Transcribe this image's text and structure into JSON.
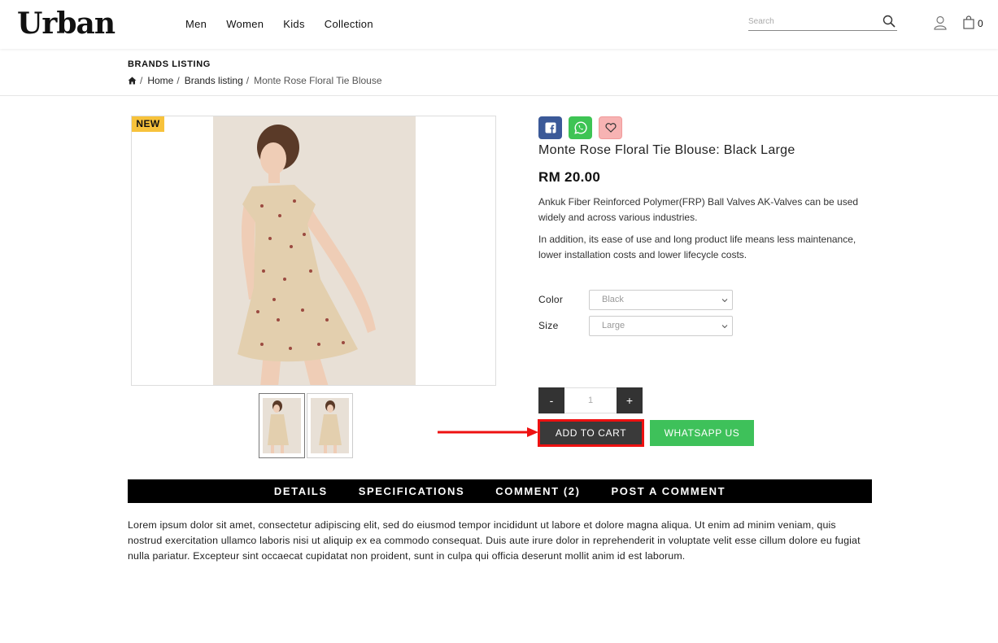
{
  "header": {
    "logo": "Urban",
    "nav": [
      "Men",
      "Women",
      "Kids",
      "Collection"
    ],
    "search_placeholder": "Search",
    "cart_count": "0"
  },
  "breadcrumb": {
    "title": "BRANDS LISTING",
    "items": [
      "Home",
      "Brands listing"
    ],
    "current": "Monte Rose Floral Tie Blouse",
    "separator": "/"
  },
  "product": {
    "badge": "NEW",
    "title": "Monte Rose Floral Tie Blouse: Black Large",
    "price": "RM 20.00",
    "description": [
      "Ankuk Fiber Reinforced Polymer(FRP) Ball Valves AK-Valves can be used widely and across various industries.",
      "In addition, its ease of use and long product life means less maintenance, lower installation costs and lower lifecycle costs."
    ],
    "options": {
      "color_label": "Color",
      "color_value": "Black",
      "size_label": "Size",
      "size_value": "Large"
    },
    "quantity": "1",
    "qty_minus": "-",
    "qty_plus": "+",
    "add_to_cart": "ADD TO CART",
    "whatsapp": "WHATSAPP US"
  },
  "tabs": [
    "DETAILS",
    "SPECIFICATIONS",
    "COMMENT (2)",
    "POST A COMMENT"
  ],
  "details_text": "Lorem ipsum dolor sit amet, consectetur adipiscing elit, sed do eiusmod tempor incididunt ut labore et dolore magna aliqua. Ut enim ad minim veniam, quis nostrud exercitation ullamco laboris nisi ut aliquip ex ea commodo consequat. Duis aute irure dolor in reprehenderit in voluptate velit esse cillum dolore eu fugiat nulla pariatur. Excepteur sint occaecat cupidatat non proident, sunt in culpa qui officia deserunt mollit anim id est laborum.",
  "colors": {
    "facebook": "#3b5998",
    "whatsapp": "#3ec15a",
    "badge": "#f7c23b",
    "highlight": "#ee1111"
  }
}
